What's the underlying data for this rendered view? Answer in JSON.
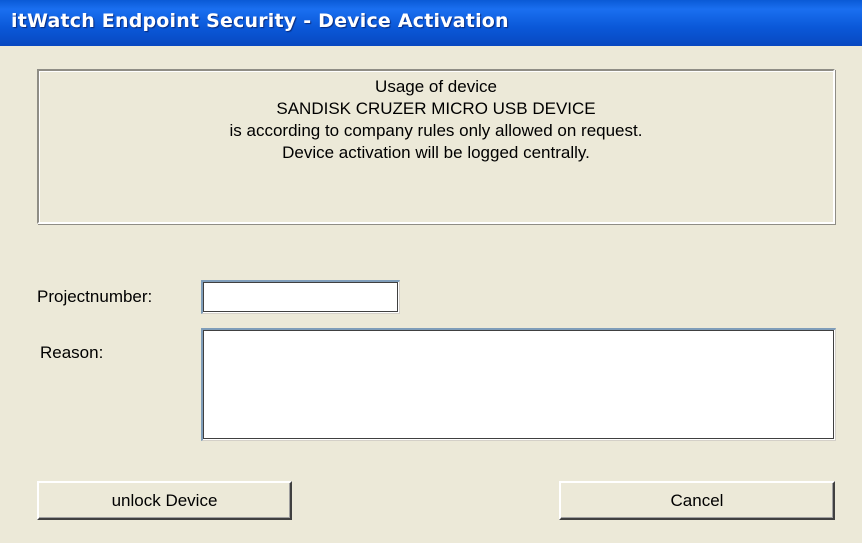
{
  "window": {
    "title": "itWatch Endpoint Security - Device Activation"
  },
  "message": {
    "line1": "Usage of device",
    "line2": "SANDISK CRUZER MICRO USB DEVICE",
    "line3": "is according to company rules only allowed on request.",
    "line4": "Device activation will be logged centrally."
  },
  "form": {
    "projectnumber_label": "Projectnumber:",
    "projectnumber_value": "",
    "reason_label": "Reason:",
    "reason_value": ""
  },
  "buttons": {
    "unlock_label": "unlock Device",
    "cancel_label": "Cancel"
  },
  "colors": {
    "titlebar": "#0a5ad6",
    "dialog_bg": "#ece9d8"
  }
}
